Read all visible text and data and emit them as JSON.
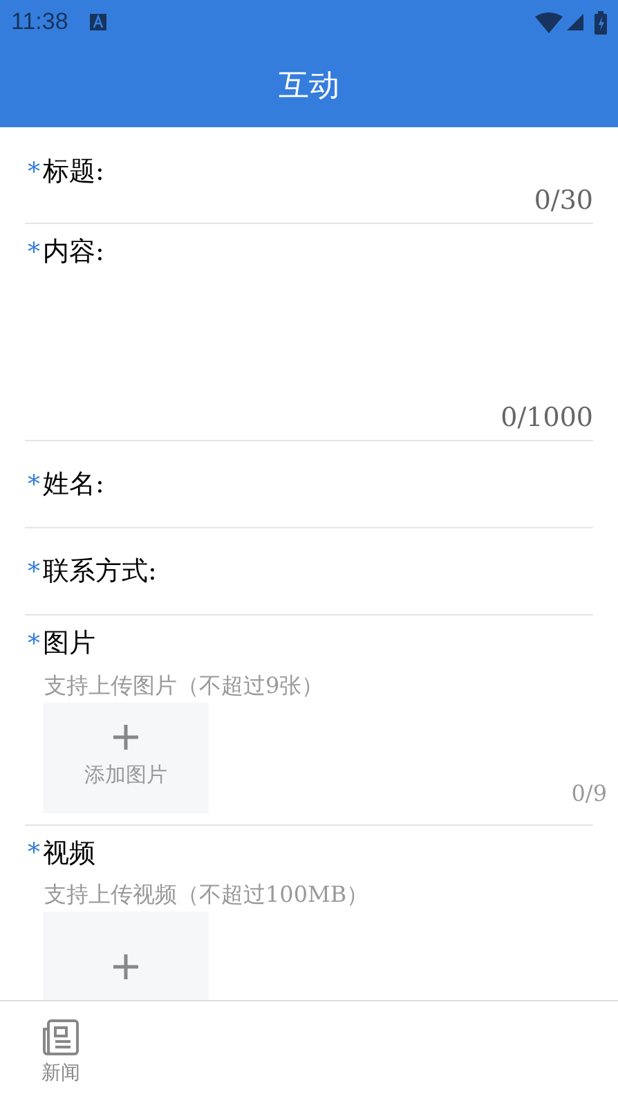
{
  "status_bar": {
    "time": "11:38"
  },
  "header": {
    "title": "互动"
  },
  "fields": [
    {
      "kind": "text",
      "required_mark": "*",
      "label": "标题:",
      "counter": "0/30"
    },
    {
      "kind": "textarea",
      "required_mark": "*",
      "label": "内容:",
      "counter": "0/1000"
    },
    {
      "kind": "input",
      "required_mark": "*",
      "label": "姓名:"
    },
    {
      "kind": "input",
      "required_mark": "*",
      "label": "联系方式:"
    },
    {
      "kind": "upload",
      "required_mark": "*",
      "label": "图片",
      "hint": "支持上传图片（不超过9张）",
      "button": "添加图片",
      "counter": "0/9"
    },
    {
      "kind": "upload",
      "required_mark": "*",
      "label": "视频",
      "hint": "支持上传视频（不超过100MB）"
    }
  ],
  "bottom_nav": [
    {
      "label": "新闻",
      "selected": false
    }
  ]
}
